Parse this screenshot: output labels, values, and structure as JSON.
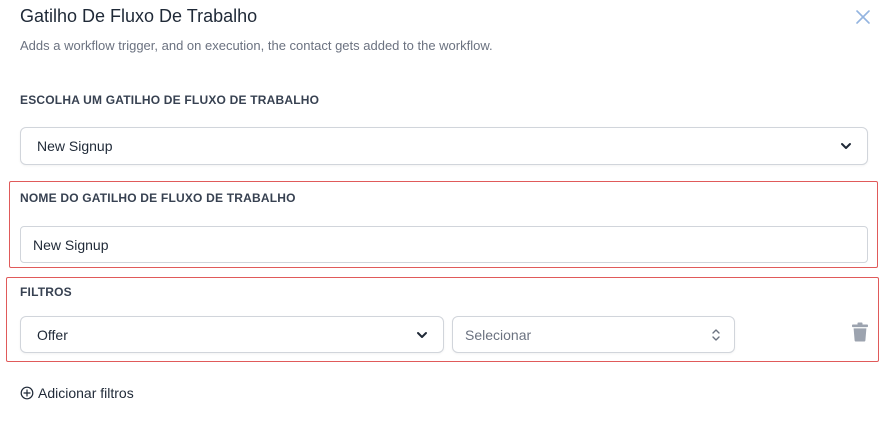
{
  "modal": {
    "title": "Gatilho De Fluxo De Trabalho",
    "subtitle": "Adds a workflow trigger, and on execution, the contact gets added to the workflow."
  },
  "trigger_select": {
    "label": "ESCOLHA UM GATILHO DE FLUXO DE TRABALHO",
    "value": "New Signup"
  },
  "trigger_name": {
    "label": "NOME DO GATILHO DE FLUXO DE TRABALHO",
    "value": "New Signup"
  },
  "filters": {
    "label": "FILTROS",
    "field_value": "Offer",
    "operator_placeholder": "Selecionar",
    "add_label": "Adicionar filtros"
  },
  "icons": {
    "close": "close-icon",
    "chevron": "chevron-down-icon",
    "sort": "updown-chevron-icon",
    "trash": "trash-icon",
    "add": "plus-circle-icon"
  },
  "colors": {
    "highlight": "#e05a5a",
    "border": "#d1d5db",
    "muted_text": "#6b7280",
    "text": "#1f2937",
    "trash": "#9ca3af"
  }
}
